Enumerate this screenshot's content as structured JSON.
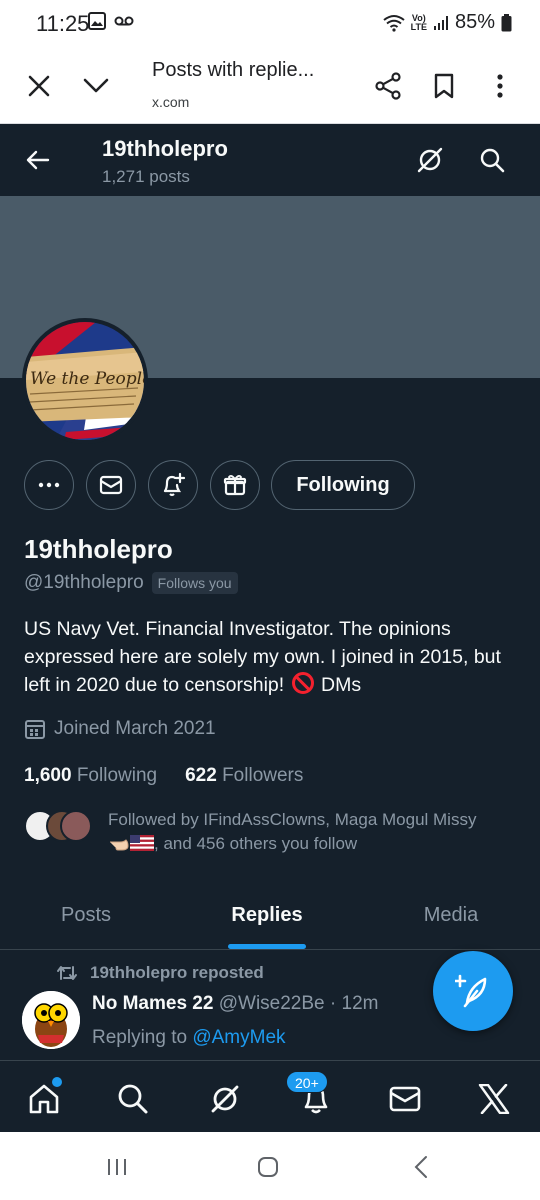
{
  "status_bar": {
    "time": "11:25",
    "battery": "85%",
    "network": "LTE"
  },
  "browser": {
    "page_title": "Posts with replie...",
    "url": "x.com"
  },
  "header": {
    "name": "19thholepro",
    "posts_count": "1,271 posts"
  },
  "profile": {
    "display_name": "19thholepro",
    "handle": "@19thholepro",
    "follows_you": "Follows you",
    "bio_text": "US Navy Vet. Financial Investigator. The opinions expressed here are solely my own. I joined in 2015, but left in 2020 due to censorship!",
    "bio_suffix": "DMs",
    "joined": "Joined March 2021",
    "following_count": "1,600",
    "following_label": "Following",
    "followers_count": "622",
    "followers_label": "Followers",
    "followed_by_line1": "Followed by IFindAssClowns, Maga Mogul Missy",
    "followed_by_line2": ", and 456 others you follow",
    "following_button": "Following",
    "avatar_text": "We the People"
  },
  "tabs": [
    {
      "label": "Posts"
    },
    {
      "label": "Replies"
    },
    {
      "label": "Media"
    }
  ],
  "tweet": {
    "repost_label": "19thholepro reposted",
    "author_name": "No Mames 22",
    "author_handle": "@Wise22Be",
    "separator": "·",
    "time": "12m",
    "replying_prefix": "Replying to",
    "replying_to": "@AmyMek"
  },
  "bottom_nav": {
    "notifications_badge": "20+"
  },
  "colors": {
    "background": "#15202b",
    "accent": "#1d9bf0",
    "muted_text": "#8b98a5",
    "banner": "#4a5b68"
  }
}
